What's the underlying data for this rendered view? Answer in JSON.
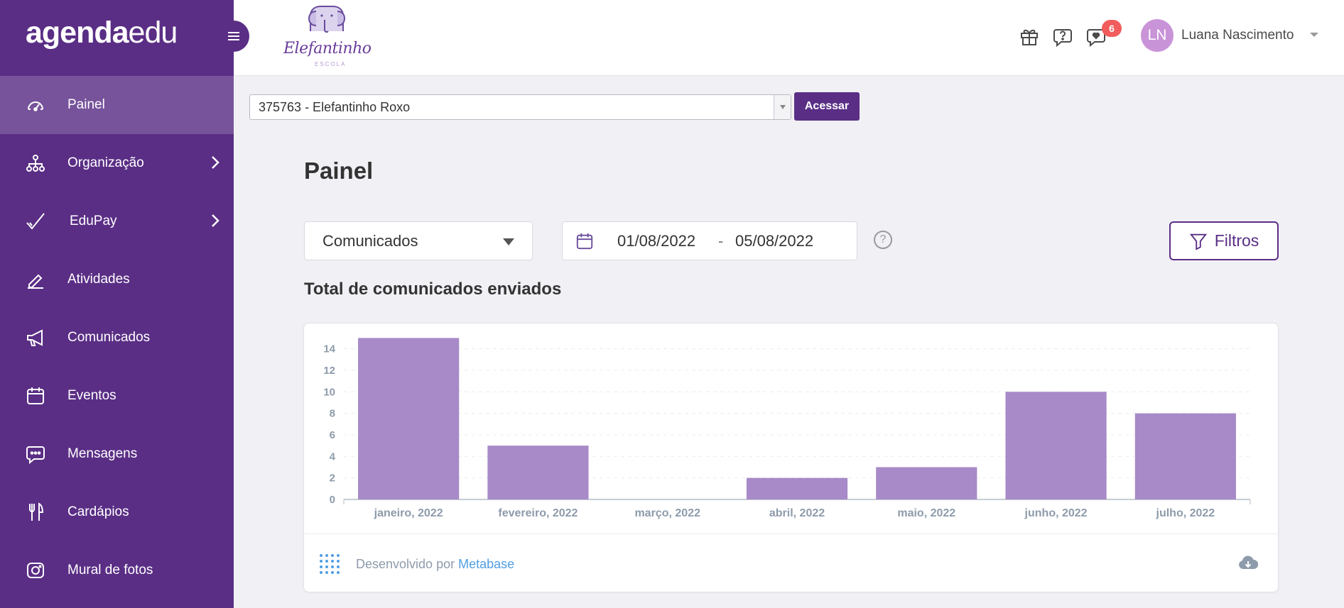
{
  "brand": {
    "part1": "agenda",
    "part2": "edu"
  },
  "sidebar": {
    "items": [
      {
        "label": "Painel",
        "icon": "speedometer-icon",
        "active": true
      },
      {
        "label": "Organização",
        "icon": "org-chart-icon",
        "has_submenu": true
      },
      {
        "label": "EduPay",
        "icon": "checkmark-icon",
        "has_submenu": true
      },
      {
        "label": "Atividades",
        "icon": "pencil-icon"
      },
      {
        "label": "Comunicados",
        "icon": "megaphone-icon"
      },
      {
        "label": "Eventos",
        "icon": "calendar-icon"
      },
      {
        "label": "Mensagens",
        "icon": "chat-icon"
      },
      {
        "label": "Cardápios",
        "icon": "cutlery-icon"
      },
      {
        "label": "Mural de fotos",
        "icon": "camera-icon"
      }
    ]
  },
  "header": {
    "school_logo_text": "Elefantinho",
    "school_logo_sub": "ESCOLA",
    "notification_count": "6",
    "user_initials": "LN",
    "user_name": "Luana Nascimento"
  },
  "school_selector": {
    "value": "375763 - Elefantinho Roxo",
    "button": "Acessar"
  },
  "page": {
    "title": "Painel",
    "type_dropdown": "Comunicados",
    "date_start": "01/08/2022",
    "date_sep": "-",
    "date_end": "05/08/2022",
    "help": "?",
    "filter_button": "Filtros",
    "section_title": "Total de comunicados enviados"
  },
  "footer": {
    "powered_prefix": "Desenvolvido por",
    "powered_link": "Metabase"
  },
  "colors": {
    "sidebar": "#5a2e85",
    "bar": "#a78ac7",
    "accent": "#5a2e85",
    "badge": "#f25c5c"
  },
  "chart_data": {
    "type": "bar",
    "categories": [
      "janeiro, 2022",
      "fevereiro, 2022",
      "março, 2022",
      "abril, 2022",
      "maio, 2022",
      "junho, 2022",
      "julho, 2022"
    ],
    "values": [
      15,
      5,
      0,
      2,
      3,
      10,
      8
    ],
    "yticks": [
      0,
      2,
      4,
      6,
      8,
      10,
      12,
      14
    ],
    "ylim": [
      0,
      14.5
    ],
    "grid": true
  }
}
